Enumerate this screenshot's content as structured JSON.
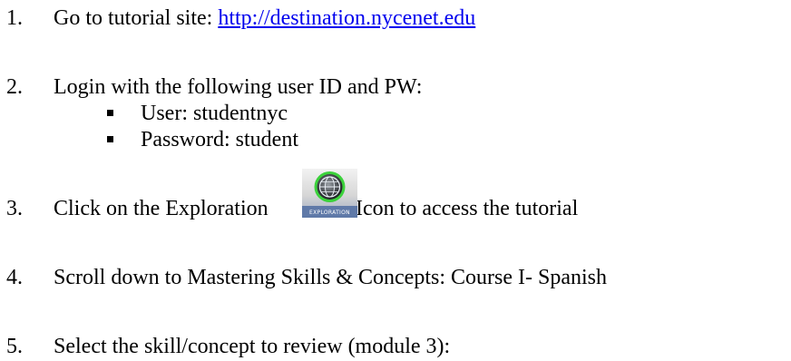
{
  "steps": [
    {
      "number": "1.",
      "prefix": "Go to tutorial site: ",
      "link": "http://destination.nycenet.edu"
    },
    {
      "number": "2.",
      "text": "Login with the following user ID and PW:",
      "bullets": [
        "User: studentnyc",
        "Password: student"
      ]
    },
    {
      "number": "3.",
      "prefix": "Click on the Exploration ",
      "suffix": " Icon to access the tutorial",
      "icon": {
        "name": "exploration-icon",
        "caption": "EXPLORATION"
      }
    },
    {
      "number": "4.",
      "text": "Scroll down to Mastering Skills & Concepts: Course I- Spanish"
    },
    {
      "number": "5.",
      "text": "Select the skill/concept to review (module 3):"
    }
  ]
}
